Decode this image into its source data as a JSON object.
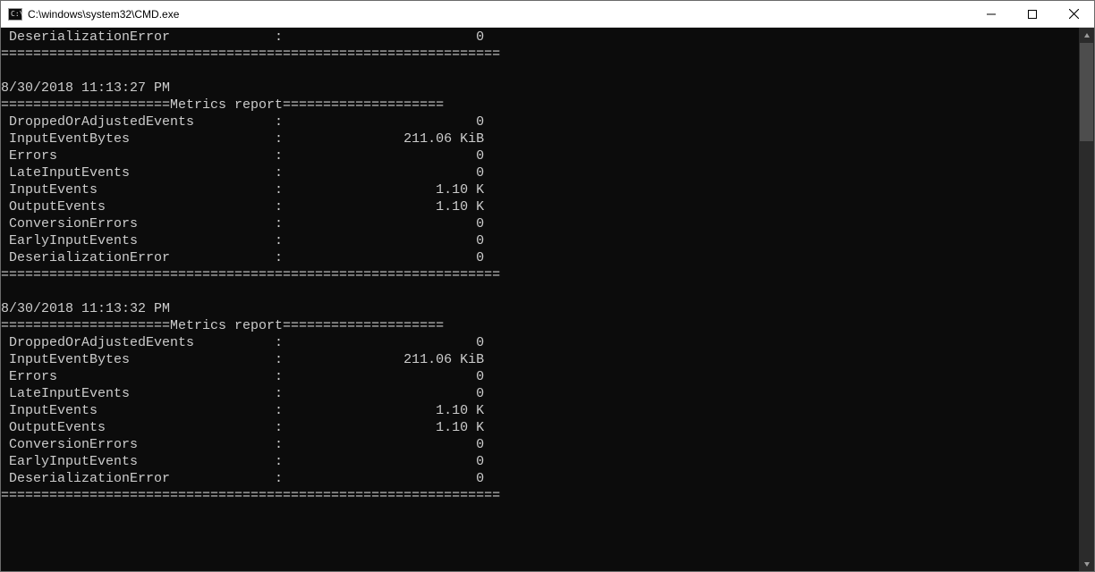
{
  "window": {
    "title": "C:\\windows\\system32\\CMD.exe"
  },
  "console": {
    "fragment_metric": {
      "label": "DeserializationError",
      "value": "0"
    },
    "fragment_footer_rule": "==============================================================",
    "report_header_prefix": "=====================",
    "report_header_label": "Metrics report",
    "report_header_suffix": "====================",
    "footer_rule": "==============================================================",
    "reports": [
      {
        "timestamp": "8/30/2018 11:13:27 PM",
        "metrics": [
          {
            "label": "DroppedOrAdjustedEvents",
            "value": "0"
          },
          {
            "label": "InputEventBytes",
            "value": "211.06 KiB"
          },
          {
            "label": "Errors",
            "value": "0"
          },
          {
            "label": "LateInputEvents",
            "value": "0"
          },
          {
            "label": "InputEvents",
            "value": "1.10 K"
          },
          {
            "label": "OutputEvents",
            "value": "1.10 K"
          },
          {
            "label": "ConversionErrors",
            "value": "0"
          },
          {
            "label": "EarlyInputEvents",
            "value": "0"
          },
          {
            "label": "DeserializationError",
            "value": "0"
          }
        ]
      },
      {
        "timestamp": "8/30/2018 11:13:32 PM",
        "metrics": [
          {
            "label": "DroppedOrAdjustedEvents",
            "value": "0"
          },
          {
            "label": "InputEventBytes",
            "value": "211.06 KiB"
          },
          {
            "label": "Errors",
            "value": "0"
          },
          {
            "label": "LateInputEvents",
            "value": "0"
          },
          {
            "label": "InputEvents",
            "value": "1.10 K"
          },
          {
            "label": "OutputEvents",
            "value": "1.10 K"
          },
          {
            "label": "ConversionErrors",
            "value": "0"
          },
          {
            "label": "EarlyInputEvents",
            "value": "0"
          },
          {
            "label": "DeserializationError",
            "value": "0"
          }
        ]
      }
    ]
  },
  "layout": {
    "label_col_width": 34,
    "value_col_width": 25
  }
}
